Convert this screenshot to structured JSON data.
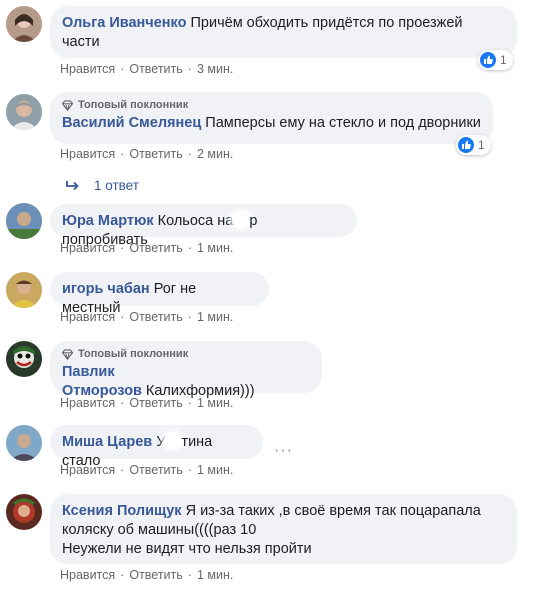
{
  "actions": {
    "like": "Нравится",
    "reply": "Ответить",
    "sep": "·"
  },
  "comments": [
    {
      "author": "Ольга Иванченко",
      "text_line1": "Причём обходить придётся по проезжей",
      "text_line2": "части",
      "time": "3 мин.",
      "reaction_count": "1"
    },
    {
      "badge": "Топовый поклонник",
      "author": "Василий Смелянец",
      "text": "Памперсы ему на стекло и под дворники",
      "time": "2 мин.",
      "reaction_count": "1",
      "replies": "1 ответ"
    },
    {
      "author": "Юра Мартюк",
      "text_a": "Кольоса на",
      "text_b": "р попробивать",
      "time": "1 мин."
    },
    {
      "author": "игорь чабан",
      "text": "Рог не местный",
      "time": "1 мин."
    },
    {
      "badge": "Топовый поклонник",
      "author": "Павлик Отморозов",
      "text": "Калихформия)))",
      "time": "1 мин."
    },
    {
      "author": "Миша Царев",
      "text_a": "У",
      "text_b": "тина стало",
      "time": "1 мин.",
      "more": "···"
    },
    {
      "author": "Ксения Полищук",
      "text_line1": "Я из-за таких ,в своё время так поцарапала",
      "text_line2": "коляску об машины((((раз 10",
      "text_line3": "Неужели не видят что нельзя пройти",
      "time": "1 мин."
    }
  ],
  "colors": {
    "author": "#385898",
    "bubble": "#f0f2f5",
    "meta": "#65676b",
    "like": "#1877f2"
  },
  "icons": {
    "like": "thumbs-up-icon",
    "badge": "diamond-icon",
    "reply_arrow": "reply-arrow-icon"
  }
}
